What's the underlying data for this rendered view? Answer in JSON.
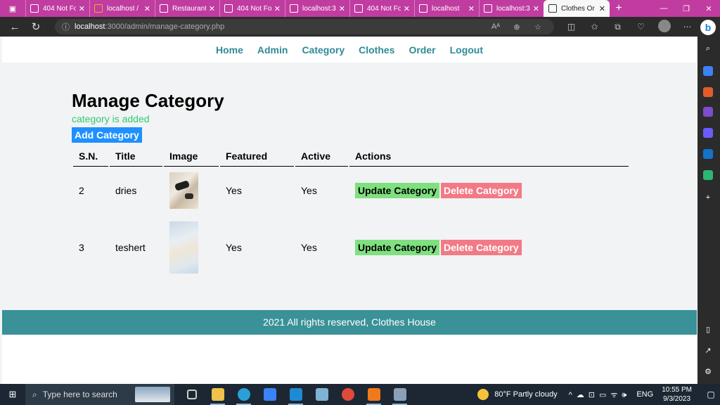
{
  "browser": {
    "tabs": [
      {
        "label": "404 Not Fo",
        "active": false
      },
      {
        "label": "localhost /",
        "active": false
      },
      {
        "label": "Restaurant",
        "active": false
      },
      {
        "label": "404 Not Fo",
        "active": false
      },
      {
        "label": "localhost:3",
        "active": false
      },
      {
        "label": "404 Not Fo",
        "active": false
      },
      {
        "label": "localhost",
        "active": false
      },
      {
        "label": "localhost:3",
        "active": false
      },
      {
        "label": "Clothes Or",
        "active": true
      }
    ],
    "url_host": "localhost",
    "url_path": ":3000/admin/manage-category.php",
    "accent_color": "#c03ca0"
  },
  "menu": {
    "items": [
      "Home",
      "Admin",
      "Category",
      "Clothes",
      "Order",
      "Logout"
    ]
  },
  "page": {
    "title": "Manage Category",
    "message": "category is added",
    "add_button": "Add Category"
  },
  "table": {
    "headers": [
      "S.N.",
      "Title",
      "Image",
      "Featured",
      "Active",
      "Actions"
    ],
    "rows": [
      {
        "sn": "2",
        "title": "dries",
        "featured": "Yes",
        "active": "Yes",
        "update": "Update Category",
        "delete": "Delete Category"
      },
      {
        "sn": "3",
        "title": "teshert",
        "featured": "Yes",
        "active": "Yes",
        "update": "Update Category",
        "delete": "Delete Category"
      }
    ]
  },
  "footer": {
    "text": "2021 All rights reserved, Clothes House"
  },
  "taskbar": {
    "search_placeholder": "Type here to search",
    "weather": "80°F  Partly cloudy",
    "language": "ENG",
    "time": "10:55 PM",
    "date": "9/3/2023"
  }
}
